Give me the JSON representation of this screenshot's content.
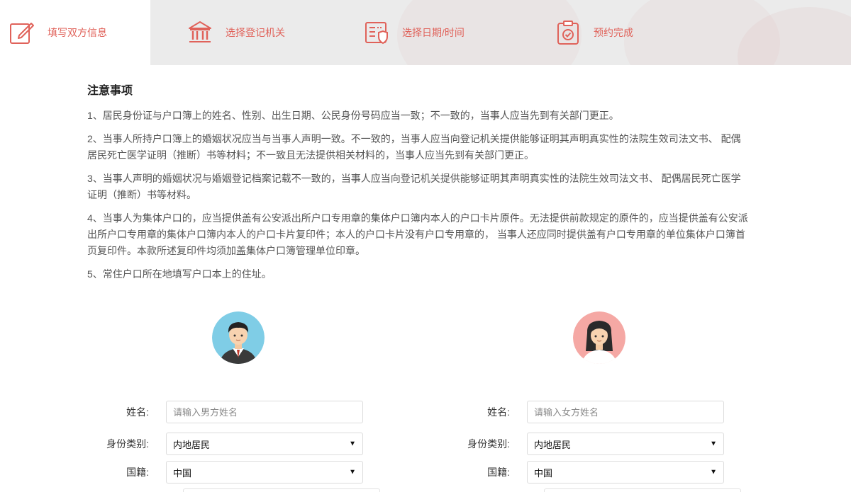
{
  "steps": [
    {
      "label": "填写双方信息",
      "icon": "edit-icon",
      "active": true
    },
    {
      "label": "选择登记机关",
      "icon": "institution-icon",
      "active": false
    },
    {
      "label": "选择日期/时间",
      "icon": "calendar-form-icon",
      "active": false
    },
    {
      "label": "预约完成",
      "icon": "clipboard-check-icon",
      "active": false
    }
  ],
  "notice": {
    "title": "注意事项",
    "items": [
      "1、居民身份证与户口簿上的姓名、性别、出生日期、公民身份号码应当一致；不一致的，当事人应当先到有关部门更正。",
      "2、当事人所持户口簿上的婚姻状况应当与当事人声明一致。不一致的，当事人应当向登记机关提供能够证明其声明真实性的法院生效司法文书、 配偶居民死亡医学证明（推断）书等材料；不一致且无法提供相关材料的，当事人应当先到有关部门更正。",
      "3、当事人声明的婚姻状况与婚姻登记档案记载不一致的，当事人应当向登记机关提供能够证明其声明真实性的法院生效司法文书、 配偶居民死亡医学证明（推断）书等材料。",
      "4、当事人为集体户口的，应当提供盖有公安派出所户口专用章的集体户口簿内本人的户口卡片原件。无法提供前款规定的原件的，应当提供盖有公安派出所户口专用章的集体户口簿内本人的户口卡片复印件；本人的户口卡片没有户口专用章的， 当事人还应同时提供盖有户口专用章的单位集体户口簿首页复印件。本款所述复印件均须加盖集体户口簿管理单位印章。",
      "5、常住户口所在地填写户口本上的住址。"
    ]
  },
  "male": {
    "name_label": "姓名:",
    "name_placeholder": "请输入男方姓名",
    "id_type_label": "身份类别:",
    "id_type_value": "内地居民",
    "nationality_label": "国籍:",
    "nationality_value": "中国"
  },
  "female": {
    "name_label": "姓名:",
    "name_placeholder": "请输入女方姓名",
    "id_type_label": "身份类别:",
    "id_type_value": "内地居民",
    "nationality_label": "国籍:",
    "nationality_value": "中国"
  },
  "colors": {
    "accent": "#e0625a",
    "male_avatar_bg": "#7fcde6",
    "female_avatar_bg": "#f5a8a4"
  }
}
